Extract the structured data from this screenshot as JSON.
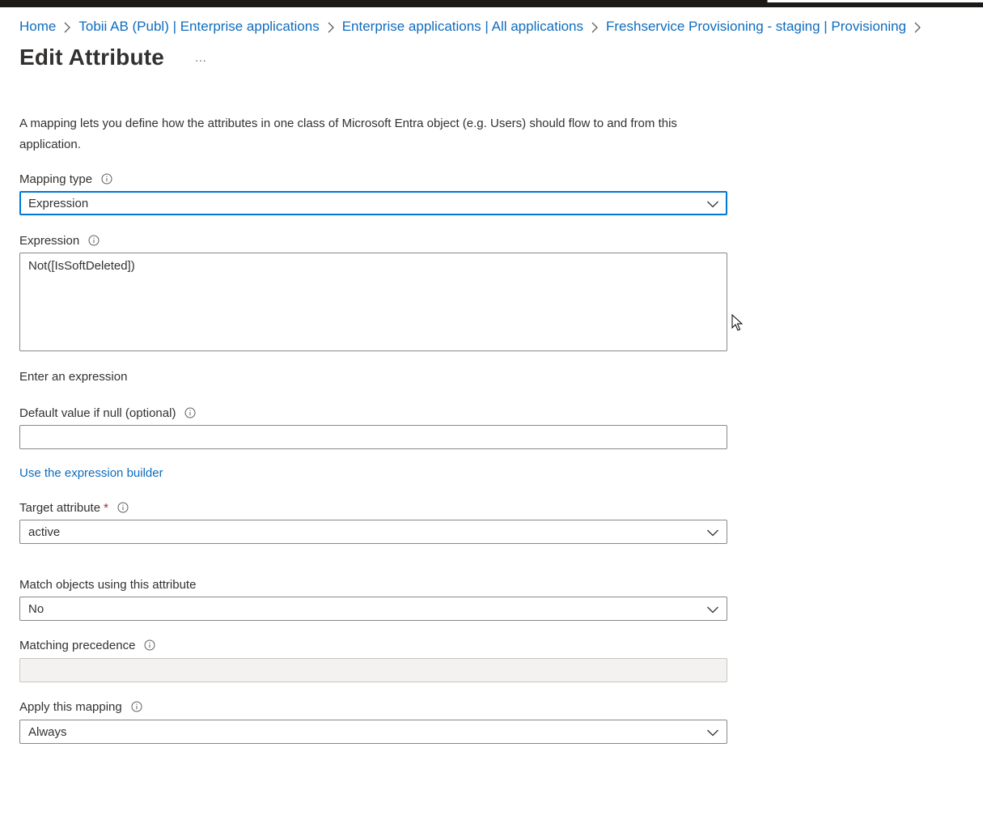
{
  "breadcrumb": {
    "items": [
      "Home",
      "Tobii AB (Publ) | Enterprise applications",
      "Enterprise applications | All applications",
      "Freshservice Provisioning - staging | Provisioning"
    ]
  },
  "page": {
    "title": "Edit Attribute",
    "more_label": "···",
    "description": "A mapping lets you define how the attributes in one class of Microsoft Entra object (e.g. Users) should flow to and from this application."
  },
  "form": {
    "mapping_type": {
      "label": "Mapping type",
      "value": "Expression"
    },
    "expression": {
      "label": "Expression",
      "value": "Not([IsSoftDeleted])",
      "helper": "Enter an expression"
    },
    "default_value": {
      "label": "Default value if null (optional)",
      "value": ""
    },
    "expression_builder_link": "Use the expression builder",
    "target_attribute": {
      "label": "Target attribute",
      "required_mark": "*",
      "value": "active"
    },
    "match_objects": {
      "label": "Match objects using this attribute",
      "value": "No"
    },
    "matching_precedence": {
      "label": "Matching precedence",
      "value": ""
    },
    "apply_mapping": {
      "label": "Apply this mapping",
      "value": "Always"
    }
  },
  "icons": {
    "info": "info-icon",
    "chevron": "chevron-down-icon",
    "separator": "chevron-right-icon",
    "cursor": "mouse-pointer-icon"
  },
  "colors": {
    "link": "#0f6cbd",
    "focus_border": "#0078d4",
    "required": "#a4262c",
    "topbar": "#1b1a19"
  }
}
